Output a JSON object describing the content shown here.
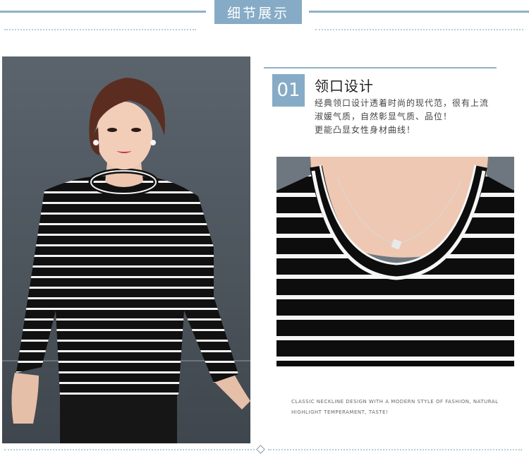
{
  "header": {
    "title": "细节展示"
  },
  "feature": {
    "number": "01",
    "title": "领口设计",
    "desc_lines": [
      "经典领口设计透着时尚的现代范，很有上流",
      "淑媛气质，自然彰显气质、品位！",
      "更能凸显女性身材曲线！"
    ]
  },
  "caption": {
    "lines": [
      "CLASSIC NECKLINE DESIGN WITH A MODERN STYLE OF FASHION, NATURAL",
      "HIGHLIGHT TEMPERAMENT, TASTE!"
    ]
  },
  "colors": {
    "accent": "#86abc6",
    "shirt": "#111111",
    "stripe": "#ffffff"
  }
}
